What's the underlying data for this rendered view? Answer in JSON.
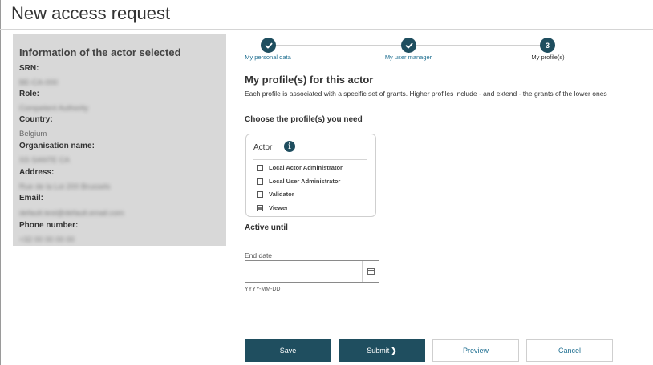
{
  "page": {
    "title": "New access request"
  },
  "actor_info": {
    "heading": "Information of the actor selected",
    "fields": [
      {
        "label": "SRN:",
        "value": "BE-CA-000"
      },
      {
        "label": "Role:",
        "value": "Competent Authority"
      },
      {
        "label": "Country:",
        "value": "Belgium"
      },
      {
        "label": "Organisation name:",
        "value": "SS SANTE CA"
      },
      {
        "label": "Address:",
        "value": "Rue de la Loi 200 Brussels"
      },
      {
        "label": "Email:",
        "value": "default.test@default.email.com"
      },
      {
        "label": "Phone number:",
        "value": "+32 00 00 00 00"
      }
    ]
  },
  "stepper": {
    "steps": [
      {
        "label": "My personal data",
        "state": "done",
        "icon": "check-icon"
      },
      {
        "label": "My user manager",
        "state": "done",
        "icon": "check-icon"
      },
      {
        "label": "My profile(s)",
        "state": "current",
        "number": "3"
      }
    ]
  },
  "profiles": {
    "title": "My profile(s) for this actor",
    "description": "Each profile is associated with a specific set of grants. Higher profiles include - and extend - the grants of the lower ones",
    "choose_label": "Choose the profile(s) you need",
    "group_label": "Actor",
    "options": [
      {
        "label": "Local Actor Administrator",
        "checked": false
      },
      {
        "label": "Local User Administrator",
        "checked": false
      },
      {
        "label": "Validator",
        "checked": false
      },
      {
        "label": "Viewer",
        "checked": true
      }
    ]
  },
  "active_until": {
    "title": "Active until",
    "end_date_label": "End date",
    "end_date_value": "",
    "format_hint": "YYYY-MM-DD"
  },
  "actions": {
    "save": "Save",
    "submit": "Submit",
    "preview": "Preview",
    "cancel": "Cancel"
  },
  "colors": {
    "primary": "#1f4e5f",
    "link": "#1f6f91",
    "panel_bg": "#d8d8d8"
  }
}
